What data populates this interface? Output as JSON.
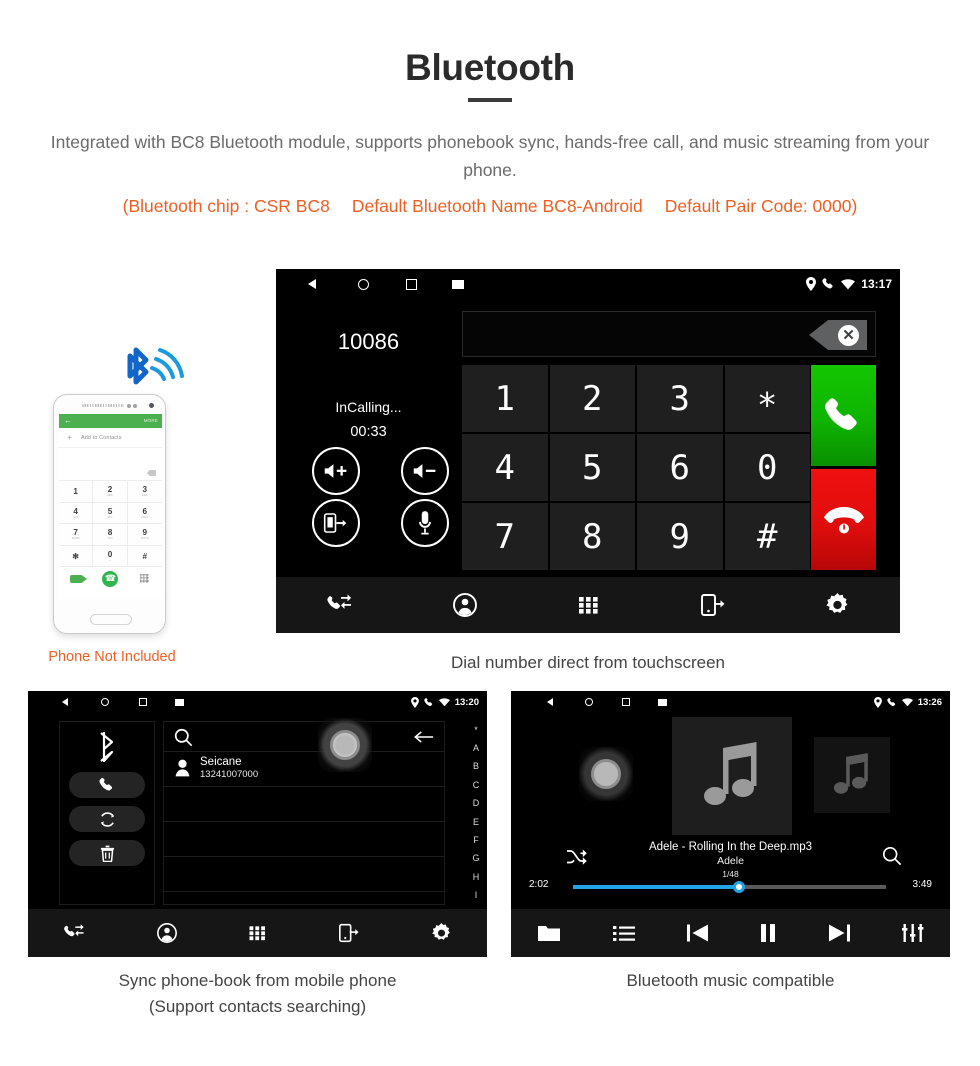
{
  "header": {
    "title": "Bluetooth",
    "description": "Integrated with BC8 Bluetooth module, supports phonebook sync, hands-free call, and music streaming from your phone.",
    "spec_line1": "(Bluetooth chip : CSR BC8",
    "spec_line2": "Default Bluetooth Name BC8-Android",
    "spec_line3": "Default Pair Code: 0000)",
    "accent_color": "#ed5f23",
    "text_color": "#6b6b6b"
  },
  "phone_mockup": {
    "bluetooth_icon": "bluetooth-signal-icon",
    "appbar_back": "←",
    "appbar_more": "MORE",
    "add_contact_plus": "+",
    "add_contact_label": "Add to Contacts",
    "keys": [
      {
        "d": "1",
        "s": ""
      },
      {
        "d": "2",
        "s": "ABC"
      },
      {
        "d": "3",
        "s": "DEF"
      },
      {
        "d": "4",
        "s": "GHI"
      },
      {
        "d": "5",
        "s": "JKL"
      },
      {
        "d": "6",
        "s": "MNO"
      },
      {
        "d": "7",
        "s": "PQRS"
      },
      {
        "d": "8",
        "s": "TUV"
      },
      {
        "d": "9",
        "s": "WXYZ"
      },
      {
        "d": "✼",
        "s": ""
      },
      {
        "d": "0",
        "s": "+"
      },
      {
        "d": "#",
        "s": ""
      }
    ],
    "caption": "Phone Not Included"
  },
  "dialer": {
    "statusbar": {
      "nav_back": "back-triangle-icon",
      "nav_home": "home-circle-icon",
      "nav_recents": "recents-square-icon",
      "nav_screenshot": "screenshot-icon",
      "location_icon": "location-pin-icon",
      "phone_icon": "phone-handset-icon",
      "wifi_icon": "wifi-icon",
      "time": "13:17"
    },
    "caller_number": "10086",
    "call_status": "InCalling...",
    "call_duration": "00:33",
    "input_value": "",
    "input_placeholder": "",
    "backspace_label": "✕",
    "controls": [
      {
        "name": "volume-up-button",
        "icon": "speaker-plus-icon"
      },
      {
        "name": "volume-down-button",
        "icon": "speaker-minus-icon"
      },
      {
        "name": "transfer-to-phone-button",
        "icon": "phone-transfer-icon"
      },
      {
        "name": "mute-microphone-button",
        "icon": "microphone-icon"
      }
    ],
    "keypad": [
      "1",
      "2",
      "3",
      "∗",
      "4",
      "5",
      "6",
      "0",
      "7",
      "8",
      "9",
      "#"
    ],
    "call_button": "call-button",
    "hangup_button": "hangup-button",
    "call_color": "#0eb400",
    "hangup_color": "#e00d0d",
    "navbar": [
      {
        "name": "nav-recent-calls",
        "icon": "phone-arrows-icon"
      },
      {
        "name": "nav-contacts",
        "icon": "contact-person-icon"
      },
      {
        "name": "nav-keypad",
        "icon": "keypad-grid-icon"
      },
      {
        "name": "nav-sync-phone",
        "icon": "phone-sync-icon"
      },
      {
        "name": "nav-settings",
        "icon": "gear-icon"
      }
    ],
    "caption": "Dial number direct from touchscreen"
  },
  "phonebook": {
    "statusbar": {
      "time": "13:20",
      "location_icon": "location-pin-icon",
      "phone_icon": "phone-handset-icon",
      "wifi_icon": "wifi-icon"
    },
    "side_buttons": [
      {
        "name": "bluetooth-status-icon",
        "icon": "bluetooth-icon"
      },
      {
        "name": "dial-button",
        "icon": "phone-handset-icon"
      },
      {
        "name": "sync-contacts-button",
        "icon": "sync-arrows-icon"
      },
      {
        "name": "delete-contacts-button",
        "icon": "trash-icon"
      }
    ],
    "search_icon": "search-magnifier-icon",
    "search_value": "",
    "search_placeholder": "",
    "back_arrow": "←",
    "contacts": [
      {
        "name": "Seicane",
        "number": "13241007000"
      }
    ],
    "empty_rows": 3,
    "alpha_index": [
      "*",
      "A",
      "B",
      "C",
      "D",
      "E",
      "F",
      "G",
      "H",
      "I"
    ],
    "navbar": [
      {
        "name": "nav-recent-calls",
        "icon": "phone-arrows-icon"
      },
      {
        "name": "nav-contacts",
        "icon": "contact-person-icon"
      },
      {
        "name": "nav-keypad",
        "icon": "keypad-grid-icon"
      },
      {
        "name": "nav-sync-phone",
        "icon": "phone-sync-icon"
      },
      {
        "name": "nav-settings",
        "icon": "gear-icon"
      }
    ],
    "caption_line1": "Sync phone-book from mobile phone",
    "caption_line2": "(Support contacts searching)"
  },
  "music": {
    "statusbar": {
      "time": "13:26",
      "location_icon": "location-pin-icon",
      "phone_icon": "phone-handset-icon",
      "wifi_icon": "wifi-icon"
    },
    "album_art_icon": "music-note-icon",
    "track_title": "Adele - Rolling In the Deep.mp3",
    "track_artist": "Adele",
    "track_index": "1/48",
    "elapsed": "2:02",
    "duration": "3:49",
    "progress_percent": 53,
    "progress_color": "#22a3e8",
    "shuffle_icon": "shuffle-icon",
    "search_icon": "search-magnifier-icon",
    "navbar": [
      {
        "name": "nav-browse-folder",
        "icon": "folder-icon"
      },
      {
        "name": "nav-playlist",
        "icon": "list-icon"
      },
      {
        "name": "nav-previous-track",
        "icon": "previous-icon"
      },
      {
        "name": "nav-pause",
        "icon": "pause-icon"
      },
      {
        "name": "nav-next-track",
        "icon": "next-icon"
      },
      {
        "name": "nav-equalizer",
        "icon": "equalizer-icon"
      }
    ],
    "caption": "Bluetooth music compatible"
  }
}
